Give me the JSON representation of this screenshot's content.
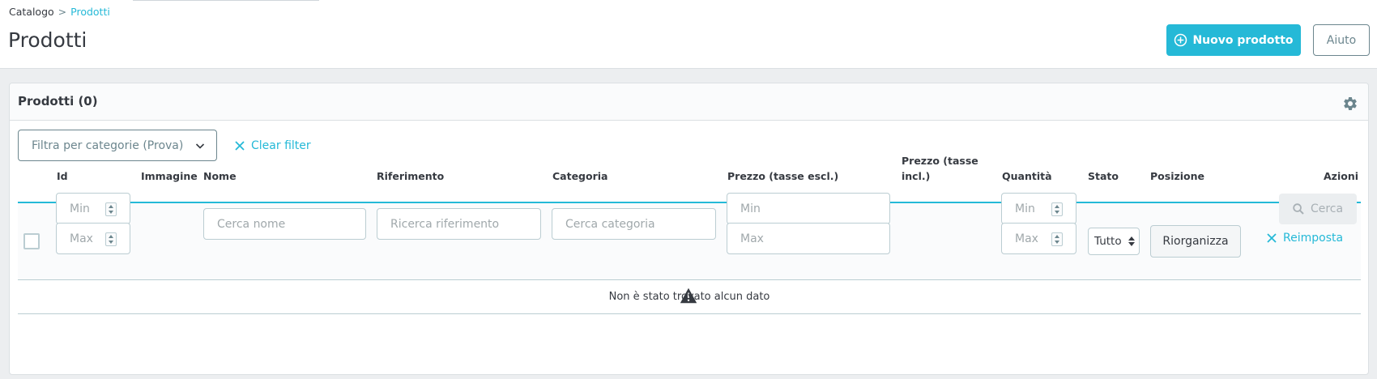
{
  "breadcrumb": {
    "parent": "Catalogo",
    "separator": ">",
    "current": "Prodotti"
  },
  "page_title": "Prodotti",
  "toolbar": {
    "new_product_label": "Nuovo prodotto",
    "help_label": "Aiuto"
  },
  "card": {
    "title": "Prodotti (0)"
  },
  "filters": {
    "category_filter_label": "Filtra per categorie (Prova)",
    "clear_filter_label": "Clear filter"
  },
  "table": {
    "columns": {
      "id": "Id",
      "image": "Immagine",
      "name": "Nome",
      "reference": "Riferimento",
      "category": "Categoria",
      "price_excl": "Prezzo (tasse escl.)",
      "price_incl": "Prezzo (tasse incl.)",
      "quantity": "Quantità",
      "status": "Stato",
      "position": "Posizione",
      "actions": "Azioni"
    },
    "filter_row": {
      "id_min_placeholder": "Min",
      "id_max_placeholder": "Max",
      "name_placeholder": "Cerca nome",
      "reference_placeholder": "Ricerca riferimento",
      "category_placeholder": "Cerca categoria",
      "price_min_placeholder": "Min",
      "price_max_placeholder": "Max",
      "qty_min_placeholder": "Min",
      "qty_max_placeholder": "Max",
      "status_value": "Tutto",
      "reorder_label": "Riorganizza",
      "search_label": "Cerca",
      "reset_label": "Reimposta"
    },
    "empty_message": "Non è stato trovato alcun dato"
  },
  "colors": {
    "accent": "#25b9d7",
    "text": "#363a41",
    "muted": "#6c868e",
    "border": "#bbcdd2"
  },
  "icons": {
    "new_product": "plus-circle-icon",
    "settings": "gear-icon",
    "dropdown": "chevron-down-icon",
    "clear": "close-icon",
    "search": "search-icon",
    "empty": "warning-icon"
  }
}
